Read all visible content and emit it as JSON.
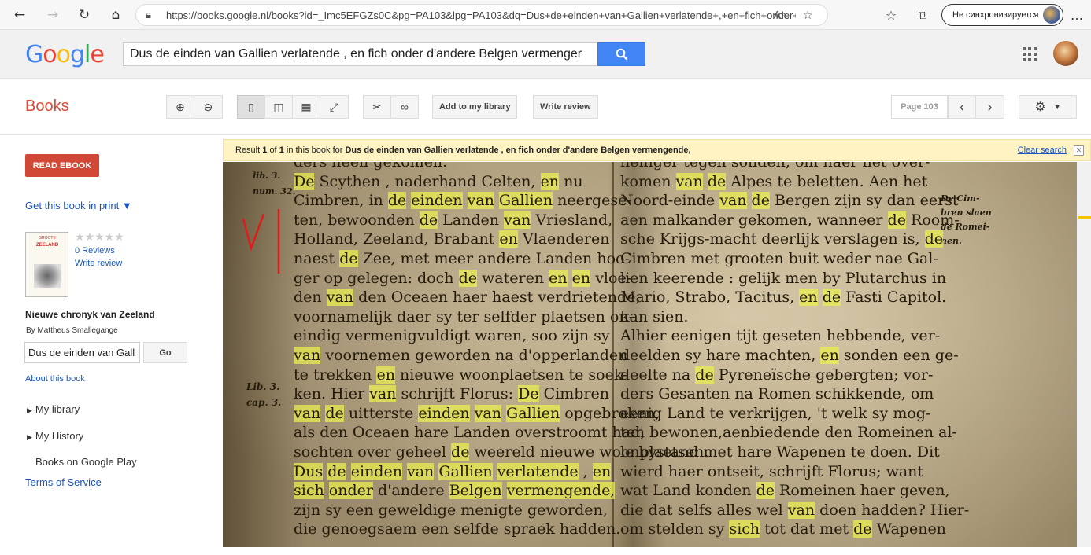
{
  "browser": {
    "url": "https://books.google.nl/books?id=_Imc5EFGZs0C&pg=PA103&lpg=PA103&dq=Dus+de+einden+van+Gallien+verlatende+,+en+fich+onder+d...",
    "sync_label": "Не синхронизируется"
  },
  "google": {
    "logo": "Google",
    "search_value": "Dus de einden van Gallien verlatende , en fich onder d'andere Belgen vermenger"
  },
  "toolbar": {
    "books_label": "Books",
    "add_library": "Add to my library",
    "write_review": "Write review",
    "page": "Page 103"
  },
  "sidebar": {
    "read_ebook": "READ EBOOK",
    "get_print": "Get this book in print ▼",
    "cover_title_top": "GROOTE",
    "cover_title": "ZEELAND",
    "stars": "★★★★★",
    "reviews": "0 Reviews",
    "write_review": "Write review",
    "book_title": "Nieuwe chronyk van Zeeland",
    "byline": "By Mattheus Smallegange",
    "search_value": "Dus de einden van Gall",
    "go": "Go",
    "about": "About this book",
    "my_library": "My library",
    "my_history": "My History",
    "play": "Books on Google Play",
    "terms": "Terms of Service"
  },
  "banner": {
    "result": "Result",
    "n1": "1",
    "of": "of",
    "n2": "1",
    "in_book": "in this book for",
    "query": "Dus de einden van Gallien verlatende , en fich onder d'andere Belgen vermengende,",
    "clear": "Clear search"
  },
  "scan": {
    "margin_left_1": "lib. 3.\nnum. 32.",
    "margin_left_2": "Lib. 3.\ncap. 3.",
    "margin_right": "De Cim-\nbren slaen\nde Romei-\nnen.",
    "left_lines": [
      "ders heen gekomen.",
      "De Scythen , naderhand Celten, en nu",
      "Cimbren, in de einden van Gallien neergese-",
      "ten, bewoonden de Landen van Vriesland,",
      "Holland, Zeeland, Brabant en Vlaenderen",
      "naest de Zee, met meer andere Landen hoo-",
      "ger op gelegen: doch de wateren en en vloe-",
      "den van den Oceaen haer haest verdrietende,",
      "voornamelijk daer sy ter selfder plaetsen on-",
      "eindig vermenigvuldigt waren, soo zijn sy",
      "van voornemen geworden na d'opperlanden",
      "te trekken en nieuwe woonplaetsen te soek-",
      "ken. Hier van schrijft Florus: De Cimbren",
      "van de uitterste einden van Gallien opgebroken,",
      "als den Oceaen hare Landen overstroomt had,",
      "sochten over geheel de weereld nieuwe woonplaetsen.",
      "Dus de einden van Gallien verlatende , en",
      "sich onder d'andere Belgen vermengende,",
      "zijn sy een geweldige menigte geworden,",
      "die genoegsaem een selfde spraek hadden."
    ],
    "right_lines": [
      "heiliger tegen sonden, om haer het over-",
      "komen van de Alpes te beletten. Aen het",
      "Noord-einde van de Bergen zijn sy dan eerst",
      "aen malkander gekomen, wanneer de Room-",
      "sche Krijgs-macht deerlijk verslagen is, de",
      "Cimbren met grooten buit weder nae Gal-",
      "lien keerende : gelijk men by Plutarchus in",
      "Mario, Strabo, Tacitus, en de Fasti Capitol.",
      "kan sien.",
      "Alhier eenigen tijt geseten hebbende, ver-",
      "deelden sy hare machten, en sonden een ge-",
      "deelte na de Pyreneïsche gebergten; vor-",
      "ders Gesanten na Romen schikkende, om",
      "eenig Land te verkrijgen, 't welk sy mog-",
      "ten bewonen,aenbiedende den Romeinen al-",
      "le bystand met hare Wapenen te doen. Dit",
      "wierd haer ontseit, schrijft Florus; want",
      "wat Land konden de Romeinen haer geven,",
      "die dat selfs alles wel van doen hadden? Hier-",
      "om stelden sy sich tot dat met de Wapenen"
    ],
    "highlight_terms": [
      "De",
      "de",
      "en",
      "van",
      "einden",
      "Gallien",
      "Dus",
      "verlatende",
      "sich",
      "onder",
      "Belgen",
      "vermengende"
    ]
  }
}
